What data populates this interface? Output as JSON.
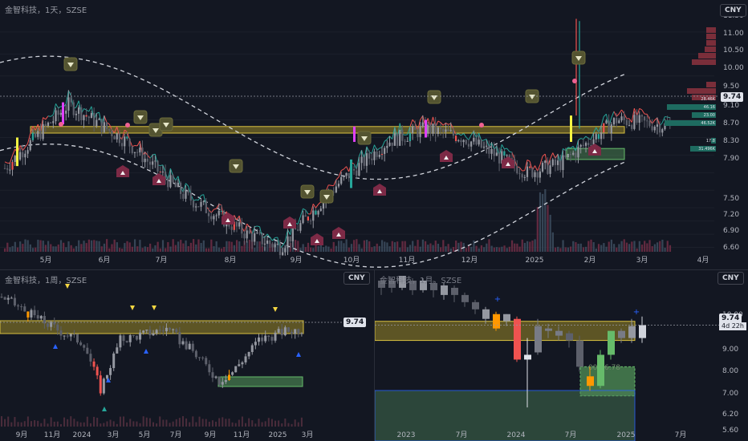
{
  "colors": {
    "bg": "#131722",
    "up": "#26a69a",
    "down": "#ef5350",
    "upCandle": "#9598a1",
    "downCandle": "#5d606b",
    "zone": "#b8a22a",
    "greenZone": "#66bb6a",
    "crimson": "#8b2b47",
    "olive": "#4a4a2a"
  },
  "top": {
    "title": "金智科技，1天，SZSE",
    "currency": "CNY",
    "last_price": "9.74",
    "y_ticks": [
      "11.50",
      "11.00",
      "10.50",
      "10.00",
      "9.50",
      "9.10",
      "8.70",
      "8.30",
      "7.90",
      "7.50",
      "7.20",
      "6.90",
      "6.60"
    ],
    "x_ticks": [
      "5月",
      "6月",
      "7月",
      "8月",
      "9月",
      "10月",
      "11月",
      "12月",
      "2025",
      "2月",
      "3月",
      "4月"
    ],
    "depth_labels": [
      "28.46K",
      "46.16",
      "23.00",
      "46.52K",
      "17.8",
      "31.496K"
    ]
  },
  "bottom_left": {
    "title": "金智科技，1周，SZSE",
    "currency": "CNY",
    "last_price": "9.74",
    "x_ticks": [
      "9月",
      "11月",
      "2024",
      "3月",
      "5月",
      "7月",
      "9月",
      "11月",
      "2025",
      "3月"
    ]
  },
  "bottom_right": {
    "title": "金智科技，1月，SZSE",
    "currency": "CNY",
    "last_price": "9.74",
    "countdown": "4d 22h",
    "y_ticks": [
      "11.00",
      "10.00",
      "9.00",
      "8.00",
      "7.00",
      "6.40",
      "5.80"
    ],
    "y_ticks_right": [
      "11.00",
      "10.00",
      "9.00",
      "8.00",
      "7.00",
      "6.20",
      "5.60",
      "5.00"
    ],
    "x_ticks": [
      "2023",
      "7月",
      "2024",
      "7月",
      "2025",
      "7月"
    ],
    "zone_text": "00 , 6.78"
  },
  "chart_data": [
    {
      "type": "candlestick",
      "title": "金智科技，1天，SZSE",
      "ylim": [
        6.5,
        11.9
      ],
      "y_ticks": [
        11.5,
        11.0,
        10.5,
        10.0,
        9.5,
        9.1,
        8.7,
        8.3,
        7.9,
        7.5,
        7.2,
        6.9,
        6.6
      ],
      "x_ticks": [
        "5月",
        "6月",
        "7月",
        "8月",
        "9月",
        "10月",
        "11月",
        "12月",
        "2025",
        "2月",
        "3月",
        "4月"
      ],
      "trend_points": [
        [
          0,
          8.4
        ],
        [
          25,
          9.85
        ],
        [
          48,
          9.0
        ],
        [
          70,
          7.8
        ],
        [
          95,
          6.9
        ],
        [
          108,
          6.6
        ],
        [
          130,
          8.0
        ],
        [
          150,
          9.0
        ],
        [
          165,
          9.3
        ],
        [
          180,
          9.1
        ],
        [
          205,
          8.3
        ],
        [
          218,
          8.5
        ],
        [
          240,
          9.5
        ],
        [
          262,
          9.35
        ]
      ],
      "zone": [
        9.2,
        9.35
      ],
      "green_zone": [
        8.6,
        8.85
      ],
      "last": 9.74
    },
    {
      "type": "candlestick",
      "title": "金智科技，1周，SZSE",
      "x_ticks": [
        "9月",
        "11月",
        "2024",
        "3月",
        "5月",
        "7月",
        "9月",
        "11月",
        "2025",
        "3月"
      ],
      "zone": [
        9.15,
        9.55
      ],
      "last": 9.74
    },
    {
      "type": "candlestick",
      "title": "金智科技，1月，SZSE",
      "ylim": [
        5.5,
        11.7
      ],
      "y_ticks": [
        11.0,
        10.0,
        9.0,
        8.0,
        7.0,
        6.4,
        5.8
      ],
      "x_ticks": [
        "2023",
        "7月",
        "2024",
        "7月",
        "2025",
        "7月"
      ],
      "zone": [
        9.1,
        9.9
      ],
      "green_zone": [
        6.78,
        8.0
      ],
      "last": 9.74
    }
  ]
}
